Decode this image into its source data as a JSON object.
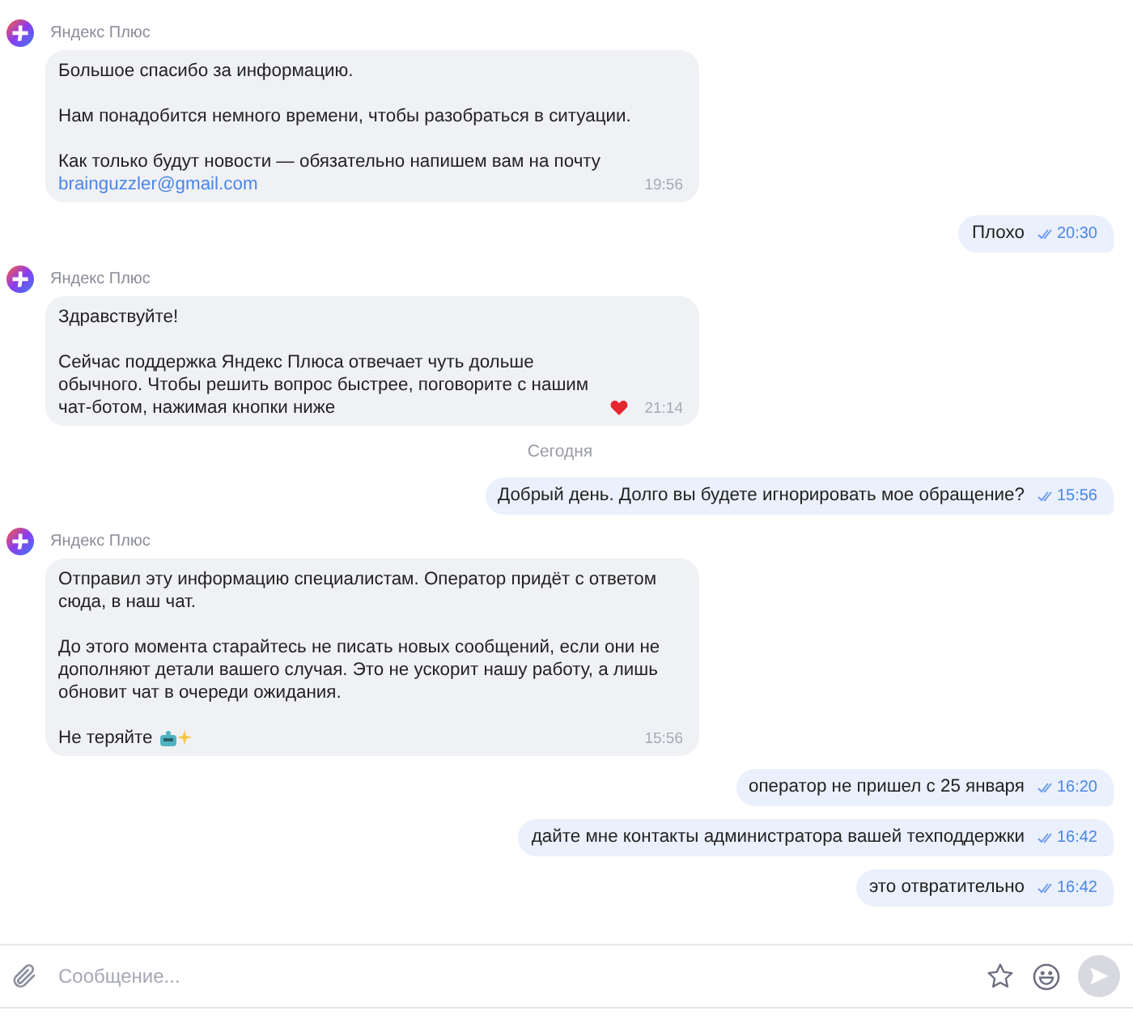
{
  "messages": [
    {
      "kind": "incoming",
      "sender": "Яндекс Плюс",
      "paragraphs": [
        {
          "kind": "plain",
          "text": "Большое спасибо за информацию."
        },
        {
          "kind": "plain",
          "text": "Нам понадобится немного времени, чтобы разобраться в ситуации."
        },
        {
          "kind": "plain",
          "text": "Как только будут новости — обязательно напишем вам на почту",
          "link": "brainguzzler@gmail.com"
        }
      ],
      "time": "19:56"
    },
    {
      "kind": "outgoing",
      "text": "Плохо",
      "time": "20:30"
    },
    {
      "kind": "incoming",
      "sender": "Яндекс Плюс",
      "paragraphs": [
        {
          "kind": "plain",
          "text": "Здравствуйте!"
        },
        {
          "kind": "heart",
          "text": "Сейчас поддержка Яндекс Плюса отвечает чуть дольше обычного. Чтобы решить вопрос быстрее, поговорите с нашим чат-ботом, нажимая кнопки ниже"
        }
      ],
      "time": "21:14"
    },
    {
      "kind": "date",
      "text": "Сегодня"
    },
    {
      "kind": "outgoing",
      "text": "Добрый день. Долго вы будете игнорировать мое обращение?",
      "time": "15:56"
    },
    {
      "kind": "incoming",
      "sender": "Яндекс Плюс",
      "paragraphs": [
        {
          "kind": "plain",
          "text": "Отправил эту информацию специалистам. Оператор придёт с ответом сюда, в наш чат."
        },
        {
          "kind": "plain",
          "text": "До этого момента старайтесь не писать новых сообщений, если они не дополняют детали вашего случая. Это не ускорит нашу работу, а лишь обновит чат в очереди ожидания."
        },
        {
          "kind": "sparkle",
          "text": "Не теряйте"
        }
      ],
      "time": "15:56"
    },
    {
      "kind": "outgoing",
      "text": "оператор не пришел с 25 января",
      "time": "16:20"
    },
    {
      "kind": "outgoing",
      "text": "дайте мне контакты администратора вашей техподдержки",
      "time": "16:42"
    },
    {
      "kind": "outgoing",
      "text": "это отвратительно",
      "time": "16:42"
    }
  ],
  "composer": {
    "placeholder": "Сообщение..."
  }
}
